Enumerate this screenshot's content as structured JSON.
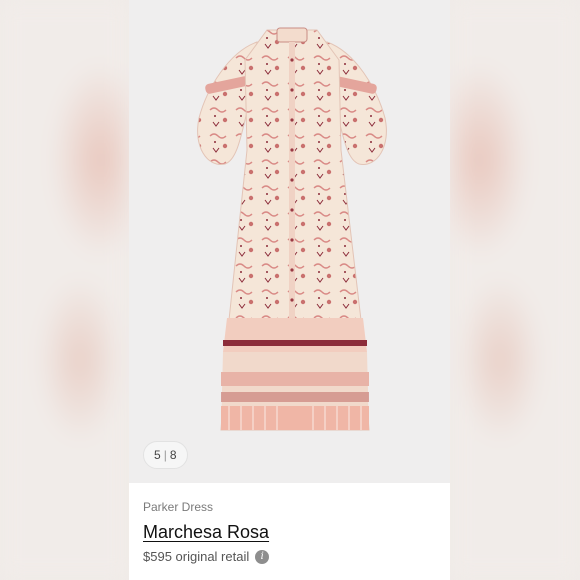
{
  "gallery": {
    "current": "5",
    "separator": "|",
    "total": "8"
  },
  "product": {
    "subtitle": "Parker Dress",
    "title": "Marchesa Rosa",
    "price_text": "$595 original retail",
    "info_icon": "info-icon",
    "image_subject": "dress-photo"
  },
  "colors": {
    "dress_base": "#f5e6d8",
    "dress_pattern": "#d98a86",
    "dress_accent": "#8c2c3a",
    "photo_bg": "#efeeee"
  }
}
